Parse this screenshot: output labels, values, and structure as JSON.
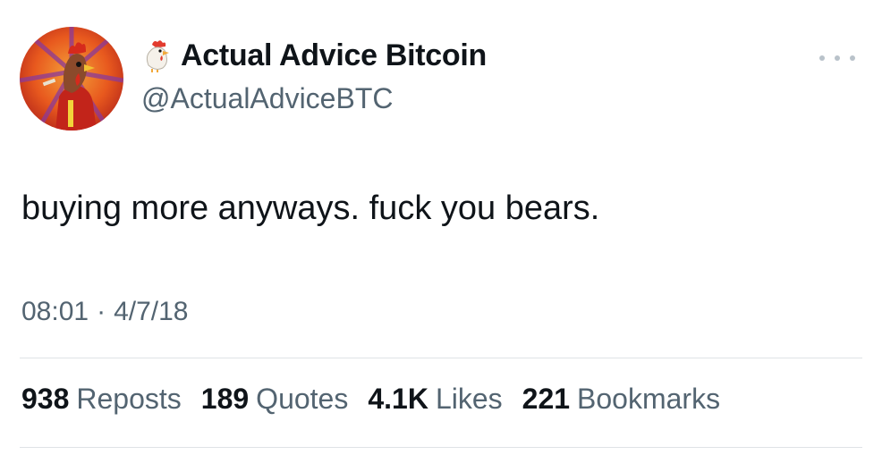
{
  "author": {
    "display_name": "Actual Advice Bitcoin",
    "handle": "@ActualAdviceBTC",
    "name_emoji": "rooster-emoji",
    "avatar": "rooster-avatar"
  },
  "tweet": {
    "text": "buying more anyways. fuck you bears.",
    "time": "08:01",
    "separator": "·",
    "date": "4/7/18"
  },
  "stats": [
    {
      "count": "938",
      "label": "Reposts"
    },
    {
      "count": "189",
      "label": "Quotes"
    },
    {
      "count": "4.1K",
      "label": "Likes"
    },
    {
      "count": "221",
      "label": "Bookmarks"
    }
  ],
  "icons": {
    "more": "more-options-icon"
  },
  "colors": {
    "text_primary": "#0f1419",
    "text_secondary": "#536471",
    "divider": "#dfe3e6"
  }
}
